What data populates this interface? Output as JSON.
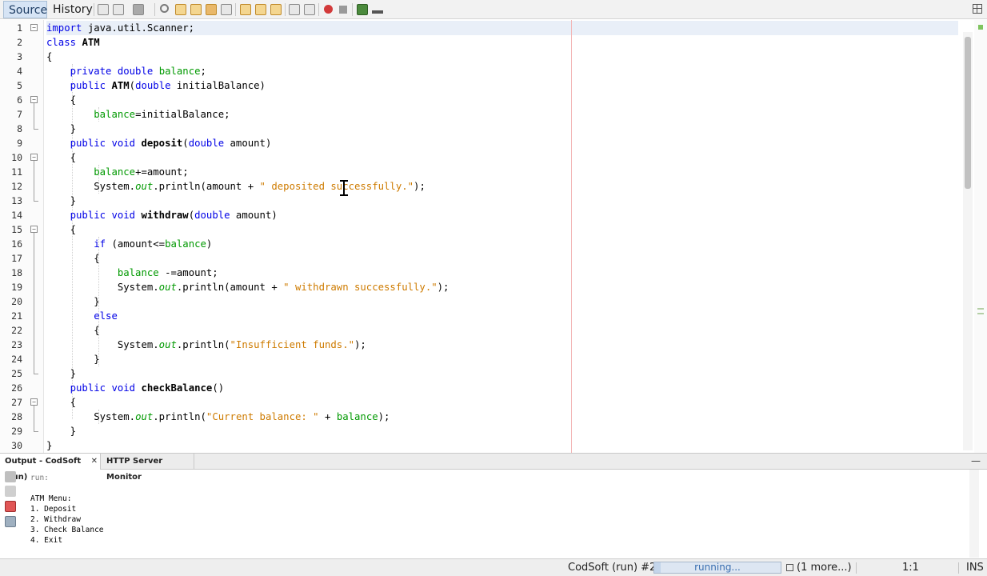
{
  "toolbar": {
    "source_tab": "Source",
    "history_tab": "History"
  },
  "editor": {
    "lines": [
      {
        "n": "1",
        "html": "<span class=\"kw\">import</span> java.util.Scanner;"
      },
      {
        "n": "2",
        "html": "<span class=\"kw\">class</span> <span class=\"b\">ATM</span>"
      },
      {
        "n": "3",
        "html": "{"
      },
      {
        "n": "4",
        "html": "    <span class=\"kw\">private double</span> <span class=\"fld\">balance</span>;"
      },
      {
        "n": "5",
        "html": "    <span class=\"kw\">public</span> <span class=\"b\">ATM</span>(<span class=\"kw\">double</span> initialBalance)"
      },
      {
        "n": "6",
        "html": "    {"
      },
      {
        "n": "7",
        "html": "        <span class=\"fld\">balance</span>=initialBalance;"
      },
      {
        "n": "8",
        "html": "    }"
      },
      {
        "n": "9",
        "html": "    <span class=\"kw\">public void</span> <span class=\"b\">deposit</span>(<span class=\"kw\">double</span> amount)"
      },
      {
        "n": "10",
        "html": "    {"
      },
      {
        "n": "11",
        "html": "        <span class=\"fld\">balance</span>+=amount;"
      },
      {
        "n": "12",
        "html": "        System.<span class=\"ital\">out</span>.println(amount + <span class=\"str\">\" deposited successfully.\"</span>);"
      },
      {
        "n": "13",
        "html": "    }"
      },
      {
        "n": "14",
        "html": "    <span class=\"kw\">public void</span> <span class=\"b\">withdraw</span>(<span class=\"kw\">double</span> amount)"
      },
      {
        "n": "15",
        "html": "    {"
      },
      {
        "n": "16",
        "html": "        <span class=\"kw\">if</span> (amount&lt;=<span class=\"fld\">balance</span>)"
      },
      {
        "n": "17",
        "html": "        {"
      },
      {
        "n": "18",
        "html": "            <span class=\"fld\">balance</span> -=amount;"
      },
      {
        "n": "19",
        "html": "            System.<span class=\"ital\">out</span>.println(amount + <span class=\"str\">\" withdrawn successfully.\"</span>);"
      },
      {
        "n": "20",
        "html": "        }"
      },
      {
        "n": "21",
        "html": "        <span class=\"kw\">else</span>"
      },
      {
        "n": "22",
        "html": "        {"
      },
      {
        "n": "23",
        "html": "            System.<span class=\"ital\">out</span>.println(<span class=\"str\">\"Insufficient funds.\"</span>);"
      },
      {
        "n": "24",
        "html": "        }"
      },
      {
        "n": "25",
        "html": "    }"
      },
      {
        "n": "26",
        "html": "    <span class=\"kw\">public void</span> <span class=\"b\">checkBalance</span>()"
      },
      {
        "n": "27",
        "html": "    {"
      },
      {
        "n": "28",
        "html": "        System.<span class=\"ital\">out</span>.println(<span class=\"str\">\"Current balance: \"</span> + <span class=\"fld\">balance</span>);"
      },
      {
        "n": "29",
        "html": "    }"
      },
      {
        "n": "30",
        "html": "}"
      }
    ]
  },
  "output": {
    "tab_output": "Output - CodSoft (run)",
    "tab_close": "✕",
    "tab_http": "HTTP Server Monitor",
    "minimize": "—",
    "lines": [
      {
        "text": "run:",
        "dim": true
      },
      {
        "text": "",
        "dim": false
      },
      {
        "text": "ATM Menu:",
        "dim": false
      },
      {
        "text": "1. Deposit",
        "dim": false
      },
      {
        "text": "2. Withdraw",
        "dim": false
      },
      {
        "text": "3. Check Balance",
        "dim": false
      },
      {
        "text": "4. Exit",
        "dim": false
      }
    ]
  },
  "status": {
    "task": "CodSoft (run) #2",
    "running": "running...",
    "progress": 0.05,
    "more": "(1 more...)",
    "position": "1:1",
    "mode": "INS"
  },
  "colors": {
    "keyword": "#0000e6",
    "field": "#009900",
    "string": "#ce7b00",
    "selected_tab": "#d6e4f5"
  }
}
